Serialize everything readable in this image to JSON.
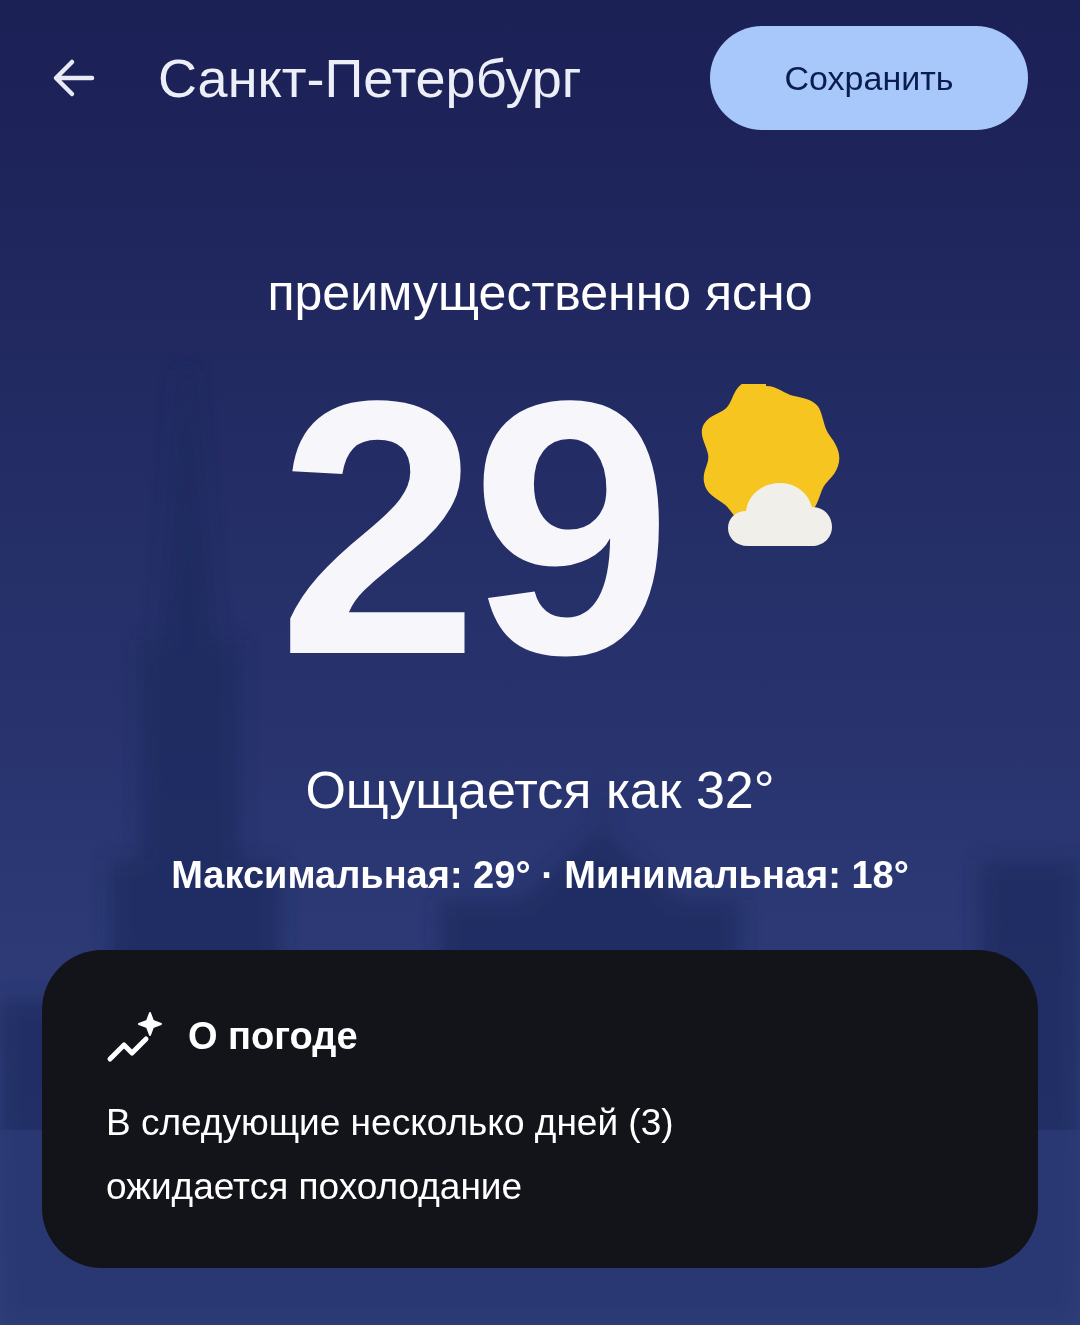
{
  "header": {
    "title": "Санкт-Петербург",
    "save_button": "Сохранить"
  },
  "condition": "преимущественно ясно",
  "temperature": "29",
  "feels_like": "Ощущается как 32°",
  "high_low": "Максимальная: 29° · Минимальная: 18°",
  "summary_card": {
    "title": "О погоде",
    "text": "В следующие несколько дней (3) ожидается похолодание"
  }
}
